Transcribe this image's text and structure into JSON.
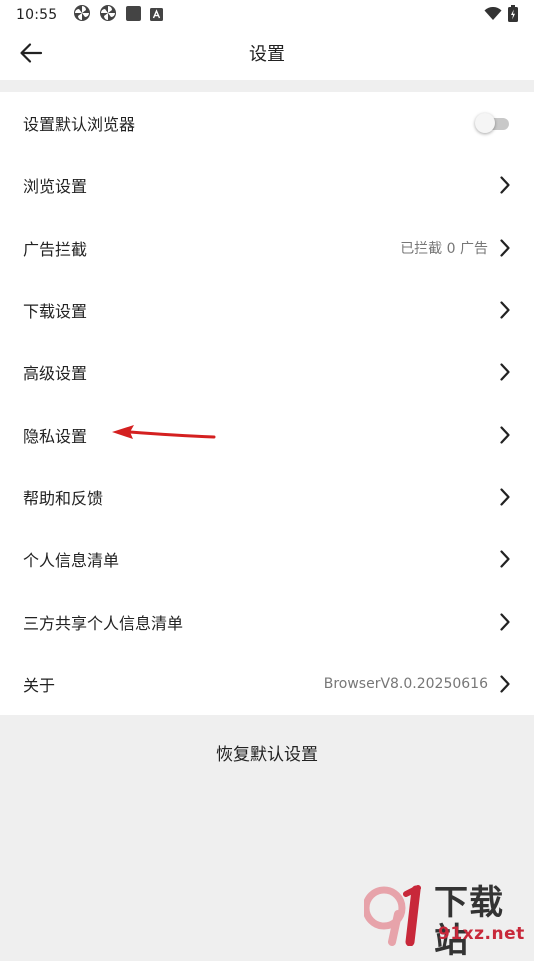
{
  "status_bar": {
    "time": "10:55",
    "left_icons": [
      "pinwheel-icon",
      "pinwheel-icon",
      "square-icon",
      "a-badge-icon"
    ],
    "right_icons": [
      "wifi-icon",
      "battery-charging-icon"
    ]
  },
  "header": {
    "title": "设置",
    "back_icon": "arrow-left-icon"
  },
  "settings": {
    "items": [
      {
        "label": "设置默认浏览器",
        "control": "toggle",
        "toggle_on": false
      },
      {
        "label": "浏览设置",
        "control": "chevron"
      },
      {
        "label": "广告拦截",
        "value": "已拦截 0 广告",
        "control": "chevron"
      },
      {
        "label": "下载设置",
        "control": "chevron"
      },
      {
        "label": "高级设置",
        "control": "chevron"
      },
      {
        "label": "隐私设置",
        "control": "chevron"
      },
      {
        "label": "帮助和反馈",
        "control": "chevron"
      },
      {
        "label": "个人信息清单",
        "control": "chevron"
      },
      {
        "label": "三方共享个人信息清单",
        "control": "chevron"
      },
      {
        "label": "关于",
        "value": "BrowserV8.0.20250616",
        "control": "chevron"
      }
    ]
  },
  "restore_label": "恢复默认设置",
  "watermark": {
    "main": "下载站",
    "url": "91xz.net"
  },
  "colors": {
    "background": "#efefef",
    "surface": "#ffffff",
    "text": "#222222",
    "secondary_text": "#777777",
    "annotation_arrow": "#d42020",
    "watermark_red": "#c8283a"
  }
}
